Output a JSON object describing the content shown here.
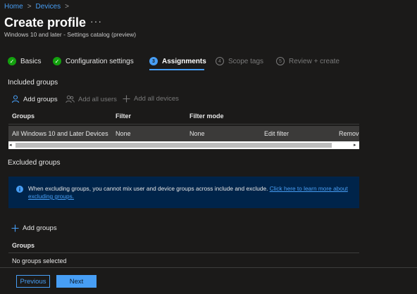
{
  "breadcrumb": {
    "home": "Home",
    "devices": "Devices",
    "sep": ">"
  },
  "page": {
    "title": "Create profile",
    "more": "···",
    "subtitle": "Windows 10 and later - Settings catalog (preview)"
  },
  "steps": [
    {
      "number": "✓",
      "label": "Basics",
      "state": "done"
    },
    {
      "number": "✓",
      "label": "Configuration settings",
      "state": "done"
    },
    {
      "number": "3",
      "label": "Assignments",
      "state": "current"
    },
    {
      "number": "4",
      "label": "Scope tags",
      "state": "todo"
    },
    {
      "number": "5",
      "label": "Review + create",
      "state": "todo"
    }
  ],
  "included": {
    "heading": "Included groups",
    "add_groups": "Add groups",
    "add_all_users": "Add all users",
    "add_all_devices": "Add all devices",
    "columns": {
      "groups": "Groups",
      "filter": "Filter",
      "filter_mode": "Filter mode"
    },
    "row": {
      "group": "All Windows 10 and Later Devices",
      "filter": "None",
      "filter_mode": "None",
      "edit_filter": "Edit filter",
      "remove": "Remove"
    }
  },
  "excluded": {
    "heading": "Excluded groups",
    "info_text": "When excluding groups, you cannot mix user and device groups across include and exclude.",
    "info_link": "Click here to learn more about excluding groups.",
    "add_groups": "Add groups",
    "column_groups": "Groups",
    "empty": "No groups selected"
  },
  "footer": {
    "previous": "Previous",
    "next": "Next"
  },
  "colors": {
    "accent": "#479ef5",
    "success": "#13a10e",
    "info_bg": "#00244a",
    "background": "#1b1a19"
  }
}
